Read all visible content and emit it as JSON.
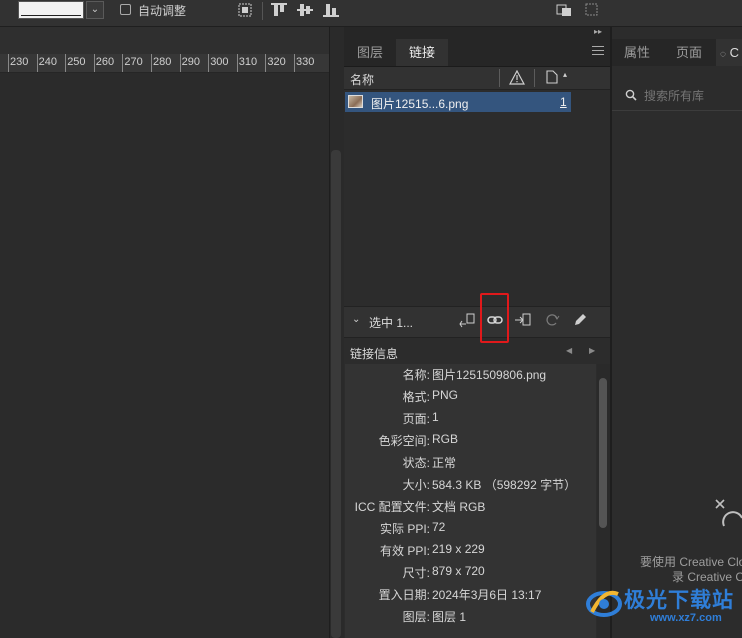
{
  "toolbar": {
    "auto_adjust_label": "自动调整",
    "dropdown_arrow": "⌄"
  },
  "ruler": {
    "labels": [
      "230",
      "240",
      "250",
      "260",
      "270",
      "280",
      "290",
      "300",
      "310",
      "320",
      "330"
    ]
  },
  "links_panel": {
    "collapse_glyph": "▸▸",
    "tabs": [
      {
        "label": "图层",
        "active": false
      },
      {
        "label": "链接",
        "active": true
      }
    ],
    "list_header": {
      "name_col": "名称",
      "warning_col_icon": "warning-icon",
      "page_col_icon": "page-icon",
      "sort_glyph": "▴"
    },
    "items": [
      {
        "name": "图片12515...6.png",
        "page": "1",
        "thumb_icon": "image-thumbnail"
      }
    ],
    "selection": {
      "label": "选中 1...",
      "expand_glyph": "⌄",
      "buttons": [
        "relink-cc-icon",
        "relink-icon",
        "goto-link-icon",
        "update-link-icon",
        "edit-original-icon"
      ]
    },
    "info": {
      "title": "链接信息",
      "nav_prev": "◀",
      "nav_next": "▶",
      "rows": [
        {
          "key": "名称:",
          "value": "图片1251509806.png"
        },
        {
          "key": "格式:",
          "value": "PNG"
        },
        {
          "key": "页面:",
          "value": "1"
        },
        {
          "key": "色彩空间:",
          "value": "RGB"
        },
        {
          "key": "状态:",
          "value": "正常"
        },
        {
          "key": "大小:",
          "value": "584.3 KB （598292 字节）"
        },
        {
          "key": "ICC 配置文件:",
          "value": "文档 RGB"
        },
        {
          "key": "实际 PPI:",
          "value": "72"
        },
        {
          "key": "有效 PPI:",
          "value": "219 x 229"
        },
        {
          "key": "尺寸:",
          "value": "879 x 720"
        },
        {
          "key": "置入日期:",
          "value": "2024年3月6日 13:17"
        },
        {
          "key": "图层:",
          "value": "图层 1"
        }
      ]
    }
  },
  "right_panel": {
    "tabs": [
      {
        "label": "属性"
      },
      {
        "label": "页面"
      },
      {
        "label": "C"
      }
    ],
    "search_placeholder": "搜索所有库",
    "message_line1": "要使用 Creative Clo",
    "message_line2": "录 Creative C"
  },
  "watermark": {
    "text": "极光下载站",
    "url": "www.xz7.com"
  },
  "colors": {
    "selection_row": "#34557e",
    "highlight_box": "#e0191b",
    "watermark": "#2f7ed8"
  }
}
